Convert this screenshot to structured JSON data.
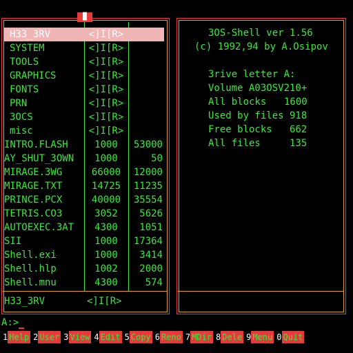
{
  "left_panel": {
    "top_marker": "▐▌",
    "selected_index": 0,
    "rows": [
      {
        "name": "H33_3RV",
        "col2": "<]I[R>",
        "col3": "",
        "type": "dir"
      },
      {
        "name": "SYSTEM",
        "col2": "<]I[R>",
        "col3": "",
        "type": "dir"
      },
      {
        "name": "TOOLS",
        "col2": "<]I[R>",
        "col3": "",
        "type": "dir"
      },
      {
        "name": "GRAPHICS",
        "col2": "<]I[R>",
        "col3": "",
        "type": "dir"
      },
      {
        "name": "FONTS",
        "col2": "<]I[R>",
        "col3": "",
        "type": "dir"
      },
      {
        "name": "PRN",
        "col2": "<]I[R>",
        "col3": "",
        "type": "dir"
      },
      {
        "name": "3OCS",
        "col2": "<]I[R>",
        "col3": "",
        "type": "dir"
      },
      {
        "name": "misc",
        "col2": "<]I[R>",
        "col3": "",
        "type": "dir"
      },
      {
        "name": "INTRO.FLASH",
        "col2": "1000",
        "col3": "53000",
        "type": "file"
      },
      {
        "name": "AY_SHUT_3OWN",
        "col2": "1000",
        "col3": "50",
        "type": "file"
      },
      {
        "name": "MIRAGE.3WG",
        "col2": "66000",
        "col3": "12000",
        "type": "file"
      },
      {
        "name": "MIRAGE.TXT",
        "col2": "14725",
        "col3": "11235",
        "type": "file"
      },
      {
        "name": "PRINCE.PCX",
        "col2": "40000",
        "col3": "35554",
        "type": "file"
      },
      {
        "name": "TETRIS.CO3",
        "col2": "3052",
        "col3": "5626",
        "type": "file"
      },
      {
        "name": "AUTOEXEC.3AT",
        "col2": "4300",
        "col3": "1051",
        "type": "file"
      },
      {
        "name": "SII",
        "col2": "1000",
        "col3": "17364",
        "type": "file"
      },
      {
        "name": "Shell.exi",
        "col2": "1000",
        "col3": "3414",
        "type": "file"
      },
      {
        "name": "Shell.hlp",
        "col2": "1002",
        "col3": "2000",
        "type": "file"
      },
      {
        "name": "Shell.mnu",
        "col2": "4300",
        "col3": "574",
        "type": "file"
      }
    ],
    "status_name": "H33_3RV",
    "status_type": "<]I[R>"
  },
  "right_panel": {
    "title": "3OS-Shell ver 1.56",
    "copyright": "(c) 1992,94 by A.Osipov",
    "drive_letter": "3rive letter A:",
    "volume": "Volume A03OSV210+",
    "all_blocks_label": "All blocks",
    "all_blocks": "1600",
    "used_label": "Used by files",
    "used": "918",
    "free_label": "Free blocks",
    "free": "662",
    "files_label": "All files",
    "files": "135"
  },
  "prompt": "A:>",
  "function_keys": [
    {
      "num": "1",
      "label": "Help"
    },
    {
      "num": "2",
      "label": "User"
    },
    {
      "num": "3",
      "label": "View"
    },
    {
      "num": "4",
      "label": "Edit"
    },
    {
      "num": "5",
      "label": "Copy"
    },
    {
      "num": "6",
      "label": "Reno"
    },
    {
      "num": "7",
      "label": "MDir"
    },
    {
      "num": "8",
      "label": "Dele"
    },
    {
      "num": "9",
      "label": "Menu"
    },
    {
      "num": "0",
      "label": "Quit"
    }
  ],
  "colors": {
    "text": "#3fe63f",
    "frame": "#e83a3a",
    "frame_inner": "#e0a020",
    "selection": "#f0b6b6"
  }
}
